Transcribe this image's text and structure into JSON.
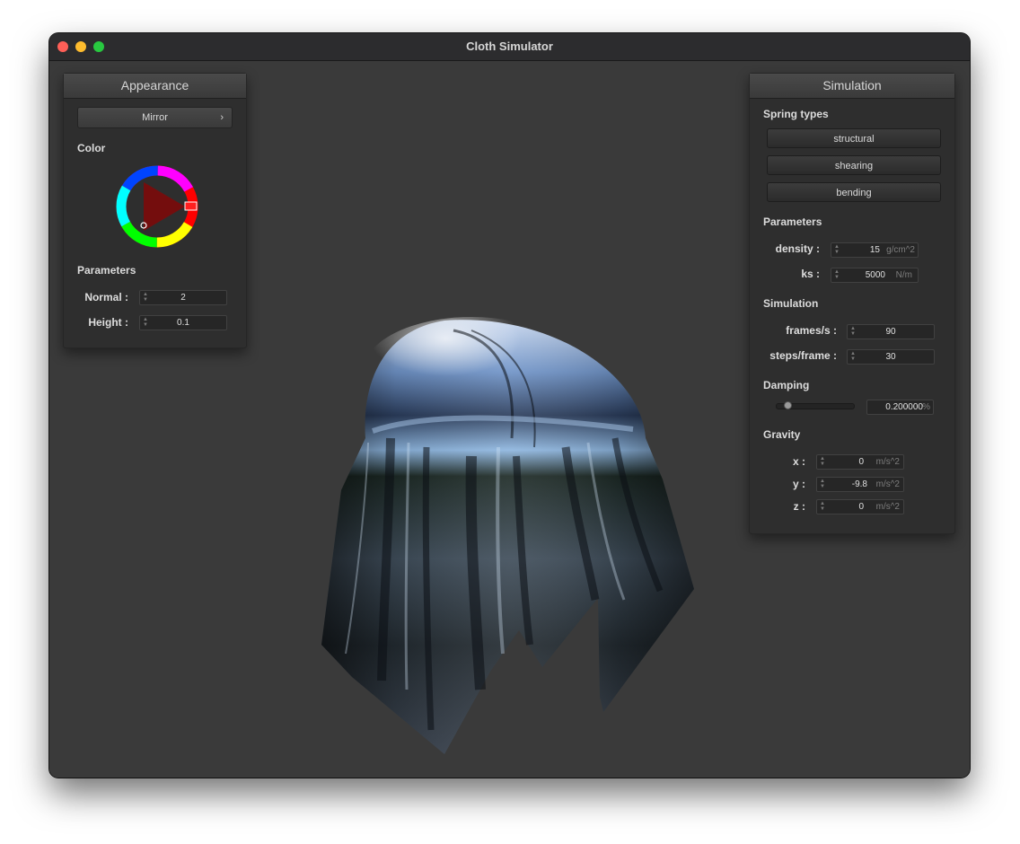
{
  "window": {
    "title": "Cloth Simulator"
  },
  "appearance": {
    "title": "Appearance",
    "shader": "Mirror",
    "color_label": "Color",
    "params_label": "Parameters",
    "normal_label": "Normal :",
    "normal_value": "2",
    "height_label": "Height :",
    "height_value": "0.1",
    "selected_color": "#ff0000"
  },
  "simulation": {
    "title": "Simulation",
    "spring_types_label": "Spring types",
    "spring_buttons": [
      "structural",
      "shearing",
      "bending"
    ],
    "params_label": "Parameters",
    "density_label": "density :",
    "density_value": "15",
    "density_unit": "g/cm^2",
    "ks_label": "ks :",
    "ks_value": "5000",
    "ks_unit": "N/m",
    "sim_label": "Simulation",
    "fps_label": "frames/s :",
    "fps_value": "90",
    "steps_label": "steps/frame :",
    "steps_value": "30",
    "damping_label": "Damping",
    "damping_value": "0.200000",
    "damping_unit": "%",
    "damping_fraction": 0.1,
    "gravity_label": "Gravity",
    "gx_label": "x :",
    "gx_value": "0",
    "gy_label": "y :",
    "gy_value": "-9.8",
    "gz_label": "z :",
    "gz_value": "0",
    "gravity_unit": "m/s^2"
  }
}
